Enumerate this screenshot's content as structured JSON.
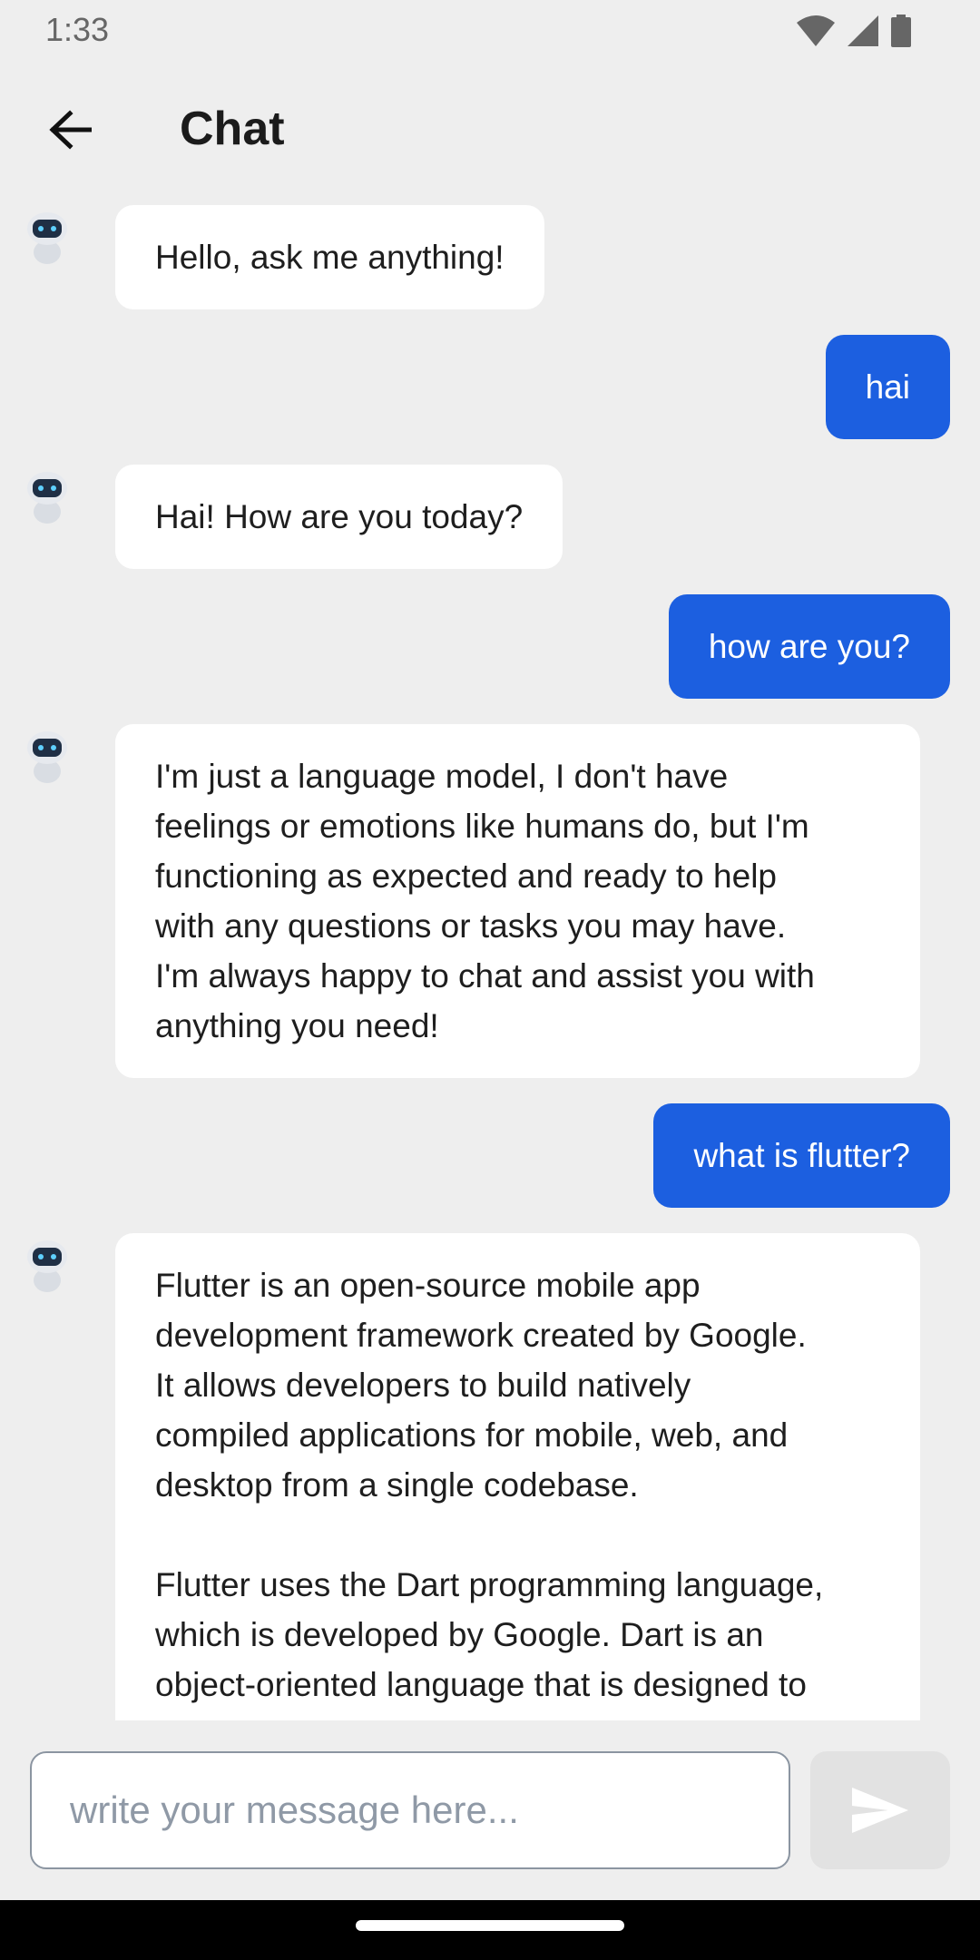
{
  "status_bar": {
    "time": "1:33"
  },
  "app_bar": {
    "title": "Chat"
  },
  "messages": [
    {
      "role": "bot",
      "text": "Hello, ask me anything!"
    },
    {
      "role": "user",
      "text": "hai"
    },
    {
      "role": "bot",
      "text": "Hai! How are you today?"
    },
    {
      "role": "user",
      "text": "how are you?"
    },
    {
      "role": "bot",
      "text": "I'm just a language model, I don't have\nfeelings or emotions like humans do, but I'm\nfunctioning as expected and ready to help\nwith any questions or tasks you may have.\nI'm always happy to chat and assist you with\nanything you need!"
    },
    {
      "role": "user",
      "text": "what is flutter?"
    },
    {
      "role": "bot",
      "text": "Flutter is an open-source mobile app\ndevelopment framework created by Google.\nIt allows developers to build natively\ncompiled applications for mobile, web, and\ndesktop from a single codebase.\n\nFlutter uses the Dart programming language,\nwhich is developed by Google. Dart is an\nobject-oriented language that is designed to\nbe easy to learn and use"
    }
  ],
  "composer": {
    "placeholder": "write your message here...",
    "value": ""
  },
  "colors": {
    "user_bubble": "#1c5fe0",
    "bot_bubble": "#ffffff",
    "background": "#eeeeee"
  },
  "icons": {
    "back": "arrow-left-icon",
    "send": "send-icon",
    "avatar": "robot-avatar-icon"
  }
}
